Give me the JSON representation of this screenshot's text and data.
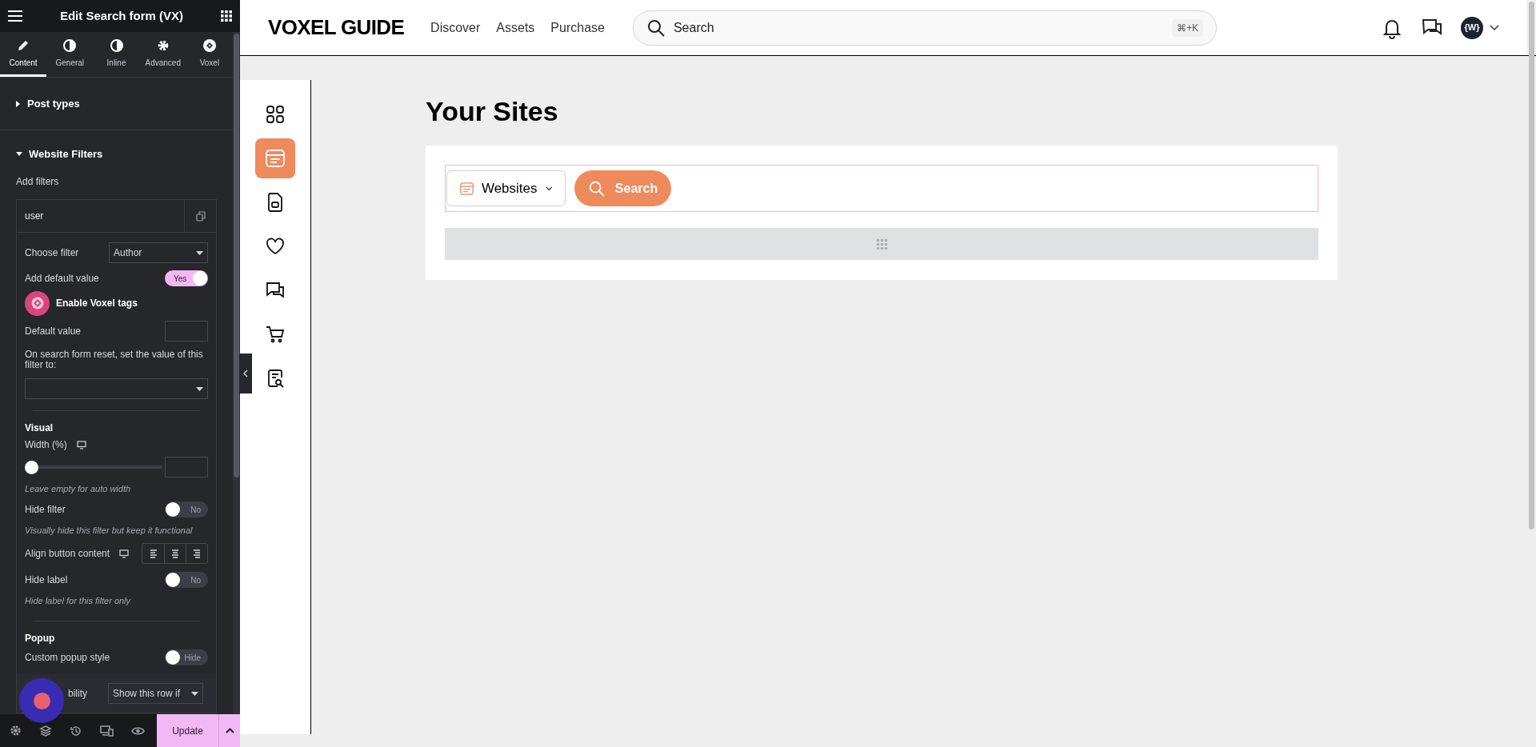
{
  "panel": {
    "title": "Edit Search form (VX)",
    "tabs": [
      {
        "label": "Content",
        "selected": true
      },
      {
        "label": "General",
        "selected": false
      },
      {
        "label": "Inline",
        "selected": false
      },
      {
        "label": "Advanced",
        "selected": false
      },
      {
        "label": "Voxel",
        "selected": false
      }
    ],
    "sections": [
      {
        "title": "Post types",
        "expanded": false
      },
      {
        "title": "Website Filters",
        "expanded": true
      }
    ],
    "add_filters_label": "Add filters",
    "filter_item": {
      "title": "user"
    },
    "controls": [
      {
        "kind": "select",
        "label": "Choose filter",
        "value": "Author"
      },
      {
        "kind": "toggle",
        "label": "Add default value",
        "on": true,
        "text": "Yes"
      },
      {
        "kind": "tags",
        "label": "Enable Voxel tags"
      },
      {
        "kind": "input",
        "label": "Default value"
      },
      {
        "kind": "wide_select",
        "label": "On search form reset, set the value of this filter to:"
      },
      {
        "kind": "heading",
        "label": "Visual"
      },
      {
        "kind": "slider",
        "label": "Width (%)",
        "level": 0
      },
      {
        "kind": "note",
        "text": "Leave empty for auto width"
      },
      {
        "kind": "toggle",
        "label": "Hide filter",
        "on": false,
        "text": "No"
      },
      {
        "kind": "note",
        "text": "Visually hide this filter but keep it functional"
      },
      {
        "kind": "align",
        "label": "Align button content"
      },
      {
        "kind": "toggle",
        "label": "Hide label",
        "on": false,
        "text": "No"
      },
      {
        "kind": "note",
        "text": "Hide label for this filter only"
      },
      {
        "kind": "heading",
        "label": "Popup"
      },
      {
        "kind": "toggle",
        "label": "Custom popup style",
        "on": false,
        "text": "Hide"
      },
      {
        "kind": "condition",
        "label": "bility",
        "value": "Show this row if"
      }
    ],
    "update_label": "Update"
  },
  "site": {
    "logo": "VOXEL GUIDE",
    "nav": [
      "Discover",
      "Assets",
      "Purchase"
    ],
    "search": {
      "placeholder": "Search",
      "shortcut": "⌘+K"
    },
    "avatar": "{W}",
    "rail": [
      {
        "selected": false
      },
      {
        "selected": true
      },
      {
        "selected": false
      },
      {
        "selected": false
      },
      {
        "selected": false
      },
      {
        "selected": false
      },
      {
        "selected": false
      }
    ],
    "heading": "Your Sites",
    "form": {
      "dropdown": "Websites",
      "button": "Search"
    }
  }
}
